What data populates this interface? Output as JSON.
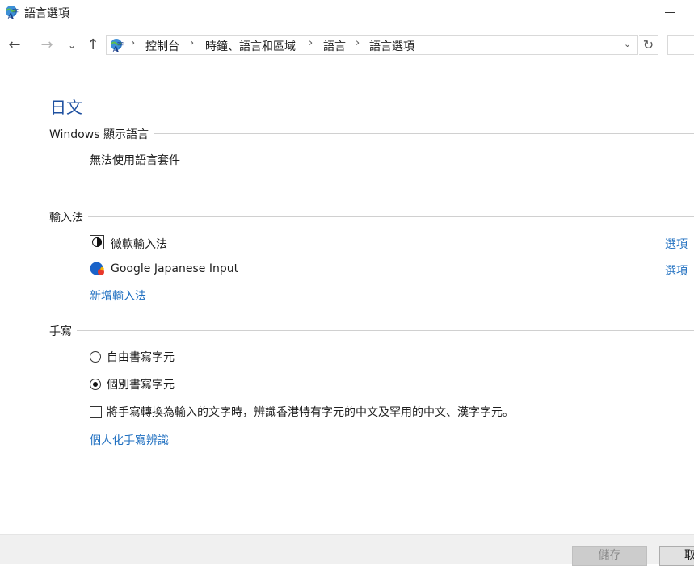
{
  "window": {
    "title": "語言選項",
    "app_icon": "language-globe-icon"
  },
  "nav": {
    "back_icon": "←",
    "forward_icon": "→",
    "recent_icon": "⌄",
    "up_icon": "↑",
    "breadcrumb": [
      "控制台",
      "時鐘、語言和區域",
      "語言",
      "語言選項"
    ],
    "separator": "›",
    "dropdown_icon": "⌄",
    "refresh_icon": "↻"
  },
  "language": {
    "heading": "日文"
  },
  "display_language": {
    "title": "Windows 顯示語言",
    "status": "無法使用語言套件"
  },
  "input_methods": {
    "title": "輸入法",
    "items": [
      {
        "name": "微軟輸入法",
        "options_label": "選項",
        "icon": "microsoft-ime-icon"
      },
      {
        "name": "Google Japanese Input",
        "options_label": "選項",
        "icon": "google-ime-icon"
      }
    ],
    "add_label": "新增輸入法"
  },
  "handwriting": {
    "title": "手寫",
    "free_mode_label": "自由書寫字元",
    "single_mode_label": "個別書寫字元",
    "selected_mode": "個別書寫字元",
    "hk_chars_label": "將手寫轉換為輸入的文字時，辨識香港特有字元的中文及罕用的中文、漢字字元。",
    "hk_chars_checked": false,
    "personalize_label": "個人化手寫辨識"
  },
  "footer": {
    "save_label": "儲存",
    "cancel_label": "取消"
  },
  "colors": {
    "link": "#1f6fc0",
    "heading": "#1e50a0"
  }
}
